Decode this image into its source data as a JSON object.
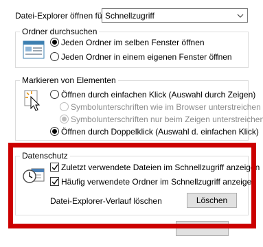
{
  "explorer_open": {
    "label": "Datei-Explorer öffnen für:",
    "selected": "Schnellzugriff"
  },
  "browse_folders": {
    "title": "Ordner durchsuchen",
    "options": [
      {
        "label": "Jeden Ordner im selben Fenster öffnen",
        "checked": true
      },
      {
        "label": "Jeden Ordner in einem eigenen Fenster öffnen",
        "checked": false
      }
    ]
  },
  "select_items": {
    "title": "Markieren von Elementen",
    "options": [
      {
        "label": "Öffnen durch einfachen Klick (Auswahl durch Zeigen)",
        "checked": false
      },
      {
        "label": "Symbolunterschriften wie im Browser unterstreichen",
        "checked": false
      },
      {
        "label": "Symbolunterschriften nur beim Zeigen unterstreichen",
        "checked": true
      },
      {
        "label": "Öffnen durch Doppelklick (Auswahl d. einfachen Klick)",
        "checked": true
      }
    ]
  },
  "privacy": {
    "title": "Datenschutz",
    "checkboxes": [
      {
        "label": "Zuletzt verwendete Dateien im Schnellzugriff anzeigen",
        "checked": true
      },
      {
        "label": "Häufig verwendete Ordner im Schnellzugriff anzeigen",
        "checked": true
      }
    ],
    "history_label": "Datei-Explorer-Verlauf löschen",
    "clear_button": "Löschen"
  },
  "colors": {
    "highlight": "#cc0000",
    "button_face": "#e1e1e1",
    "group_border": "#dcdcdc"
  }
}
